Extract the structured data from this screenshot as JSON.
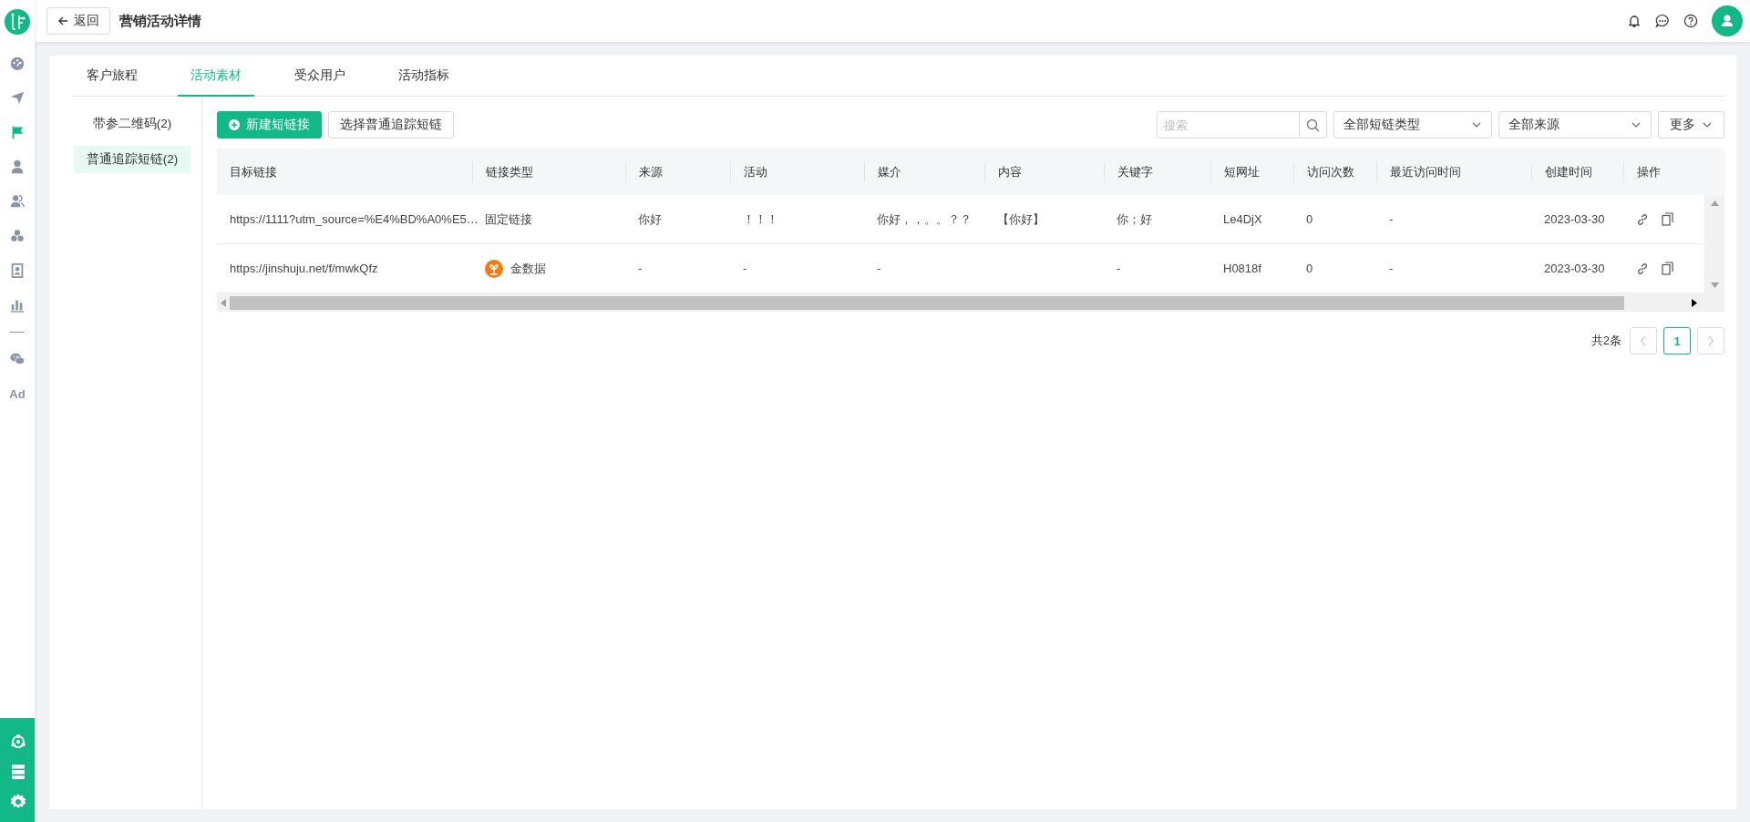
{
  "header": {
    "back_label": "返回",
    "title": "营销活动详情"
  },
  "nav": {
    "items": [
      {
        "kind": "icon",
        "selected": false
      },
      {
        "kind": "icon",
        "selected": false
      },
      {
        "kind": "icon",
        "selected": true
      },
      {
        "kind": "icon",
        "selected": false
      },
      {
        "kind": "icon",
        "selected": false
      },
      {
        "kind": "icon",
        "selected": false
      },
      {
        "kind": "icon",
        "selected": false
      },
      {
        "kind": "icon",
        "selected": false
      },
      {
        "kind": "divider"
      },
      {
        "kind": "icon",
        "selected": false
      },
      {
        "kind": "text",
        "label": "Ad",
        "selected": false
      }
    ]
  },
  "tabs": [
    {
      "label": "客户旅程",
      "selected": false
    },
    {
      "label": "活动素材",
      "selected": true
    },
    {
      "label": "受众用户",
      "selected": false
    },
    {
      "label": "活动指标",
      "selected": false
    }
  ],
  "sub_list": [
    {
      "label": "带参二维码(2)",
      "selected": false
    },
    {
      "label": "普通追踪短链(2)",
      "selected": true
    }
  ],
  "toolbar": {
    "new_button": "新建短链接",
    "select_button": "选择普通追踪短链",
    "search": {
      "placeholder": "搜索"
    },
    "filters": [
      {
        "value": "全部短链类型"
      },
      {
        "value": "全部来源"
      }
    ],
    "more": "更多"
  },
  "table": {
    "columns": [
      "目标链接",
      "链接类型",
      "来源",
      "活动",
      "媒介",
      "内容",
      "关键字",
      "短网址",
      "访问次数",
      "最近访问时间",
      "创建时间",
      "操作"
    ],
    "rows": [
      {
        "link_type_logo": false,
        "cells": [
          "https://1111?utm_source=%E4%BD%A0%E5…",
          "固定链接",
          "你好",
          "！！！",
          "你好，，。。？？",
          "【你好】",
          "你；好",
          "Le4DjX",
          "0",
          "-",
          "2023-03-30"
        ]
      },
      {
        "link_type_logo": true,
        "cells": [
          "https://jinshuju.net/f/mwkQfz",
          "金数据",
          "-",
          "-",
          "-",
          null,
          "-",
          "H0818f",
          "0",
          "-",
          "2023-03-30"
        ]
      }
    ]
  },
  "pagination": {
    "total": "共2条",
    "pages": [
      {
        "label": "1",
        "selected": true
      }
    ]
  }
}
